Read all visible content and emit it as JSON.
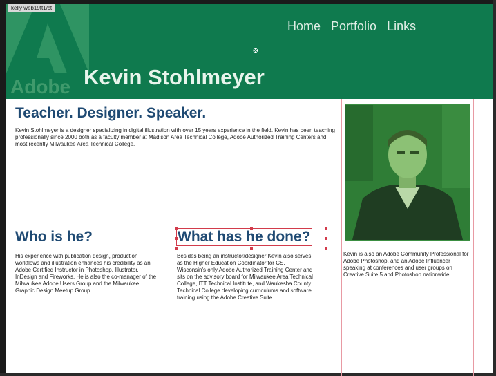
{
  "window": {
    "tab_label": "kelly web19ft1/ct"
  },
  "header": {
    "logo_text": "Adobe",
    "title": "Kevin Stohlmeyer",
    "nav": [
      "Home",
      "Portfolio",
      "Links"
    ],
    "bg_color": "#0f7a4e"
  },
  "intro": {
    "headline": "Teacher. Designer. Speaker.",
    "body": "Kevin Stohlmeyer is a designer specializing in digital illustration with over 15 years experience in the field. Kevin has been teaching professionally since 2000 both as a faculty member at Madison Area Technical College, Adobe Authorized Training Centers and most recently Milwaukee Area Technical College."
  },
  "who": {
    "heading": "Who is he?",
    "body": "His experience with publication design, production workflows and illustration enhances his credibility as an Adobe Certified Instructor in Photoshop, Illustrator, InDesign and Fireworks. He is also the co-manager of the Milwaukee Adobe Users Group and the Milwaukee Graphic Design Meetup Group."
  },
  "what": {
    "heading": "What has he done?",
    "body": "Besides being an instructor/designer Kevin also serves as the Higher Education Coordinator for CS, Wisconsin's only Adobe Authorized Training Center and sits on the advisory board for Milwaukee Area Technical College, ITT Technical Institute, and Waukesha County Technical College developing curriculums and software training using the Adobe Creative Suite."
  },
  "aside": {
    "body": "Kevin is also an Adobe Community Professional for Adobe Photoshop, and an Adobe Influencer speaking at conferences and user groups on Creative Suite 5 and Photoshop nationwide."
  },
  "icons": [
    "cursor-icon"
  ]
}
